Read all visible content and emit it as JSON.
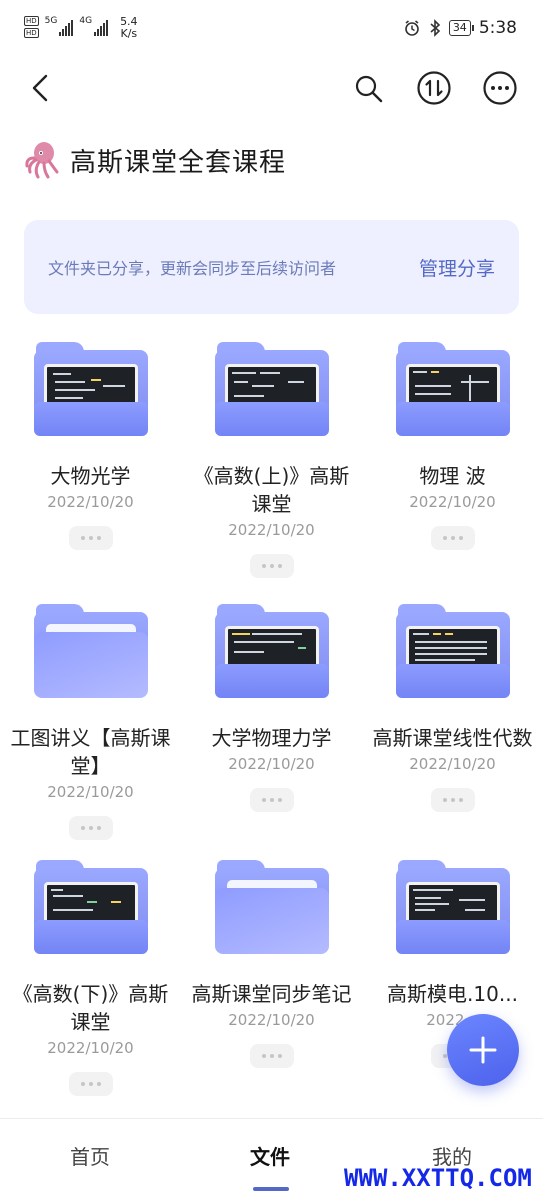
{
  "status_bar": {
    "sim1": "HD",
    "sim2": "HD",
    "net1": "5G",
    "net2": "4G",
    "speed_value": "5.4",
    "speed_unit": "K/s",
    "battery": "34",
    "time": "5:38"
  },
  "header": {
    "title": "高斯课堂全套课程"
  },
  "share_banner": {
    "message": "文件夹已分享，更新会同步至后续访问者",
    "manage_label": "管理分享"
  },
  "folders": [
    {
      "name": "大物光学",
      "date": "2022/10/20"
    },
    {
      "name": "《高数(上)》高斯课堂",
      "date": "2022/10/20"
    },
    {
      "name": "物理 波",
      "date": "2022/10/20"
    },
    {
      "name": "工图讲义【高斯课堂】",
      "date": "2022/10/20"
    },
    {
      "name": "大学物理力学",
      "date": "2022/10/20"
    },
    {
      "name": "高斯课堂线性代数",
      "date": "2022/10/20"
    },
    {
      "name": "《高数(下)》高斯课堂",
      "date": "2022/10/20"
    },
    {
      "name": "高斯课堂同步笔记",
      "date": "2022/10/20"
    },
    {
      "name": "高斯模电.10...",
      "date": "2022..."
    }
  ],
  "bottom_nav": {
    "home": "首页",
    "files": "文件",
    "mine": "我的"
  },
  "watermark": "WWW.XXTTQ.COM",
  "colors": {
    "accent": "#5468c8",
    "banner_bg": "#eef0ff",
    "folder": "#8c9cff"
  }
}
